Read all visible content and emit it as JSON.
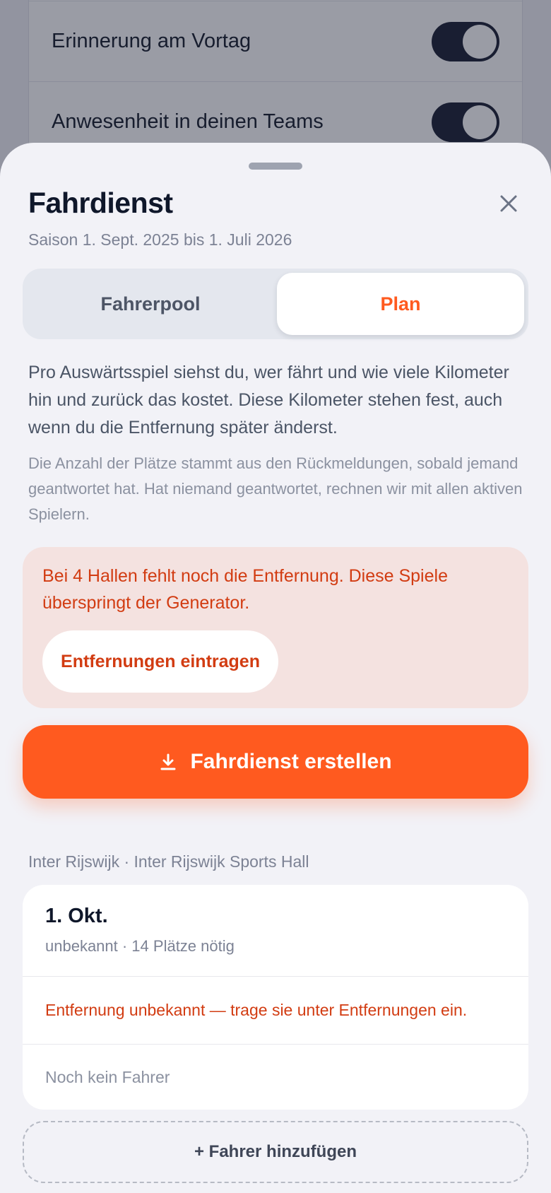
{
  "background": {
    "settings": [
      {
        "label": "Erinnerung am Vortag",
        "enabled": true
      },
      {
        "label": "Anwesenheit in deinen Teams",
        "enabled": true
      }
    ]
  },
  "sheet": {
    "title": "Fahrdienst",
    "subtitle": "Saison 1. Sept. 2025 bis 1. Juli 2026",
    "close_icon": "close-icon",
    "tabs": [
      {
        "label": "Fahrerpool",
        "active": false
      },
      {
        "label": "Plan",
        "active": true
      }
    ],
    "description": "Pro Auswärtsspiel siehst du, wer fährt und wie viele Kilometer hin und zurück das kostet. Diese Kilometer stehen fest, auch wenn du die Entfernung später änderst.",
    "note": "Die Anzahl der Plätze stammt aus den Rückmeldungen, sobald jemand geantwortet hat. Hat niemand geantwortet, rechnen wir mit allen aktiven Spielern.",
    "alert": {
      "text": "Bei 4 Hallen fehlt noch die Entfernung. Diese Spiele überspringt der Generator.",
      "button": "Entfernungen eintragen"
    },
    "primary_button": {
      "label": "Fahrdienst erstellen",
      "icon": "download-icon"
    },
    "section_header": "Inter Rijswijk · Inter Rijswijk Sports Hall",
    "game": {
      "date": "1. Okt.",
      "meta": "unbekannt · 14 Plätze nötig",
      "warning": "Entfernung unbekannt — trage sie unter Entfernungen ein.",
      "driver": "Noch kein Fahrer"
    },
    "add_driver": "+ Fahrer hinzufügen"
  },
  "colors": {
    "accent": "#ff5a1f",
    "warning_text": "#d23c12",
    "alert_bg": "#f4e2e0",
    "sheet_bg": "#f2f2f7",
    "toggle_on": "#151b2e"
  }
}
